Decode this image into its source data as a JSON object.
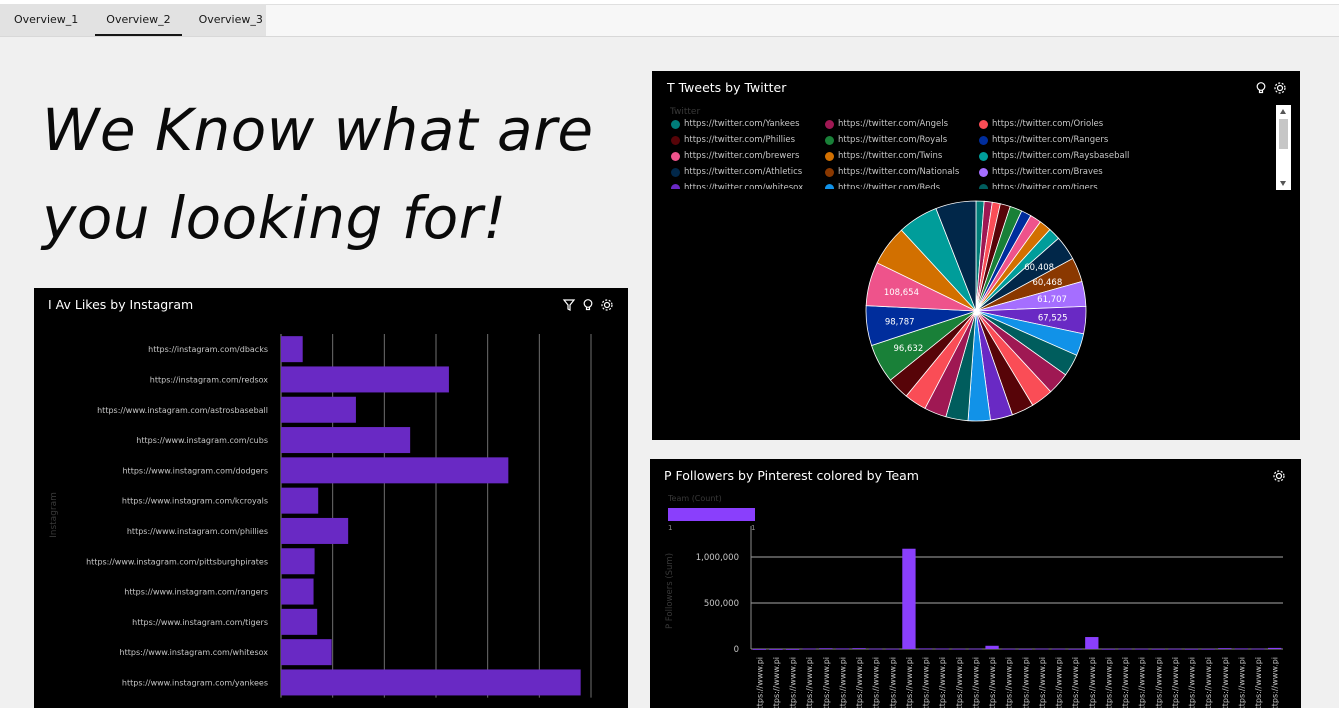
{
  "tabs": [
    {
      "label": "Overview_1"
    },
    {
      "label": "Overview_2"
    },
    {
      "label": "Overview_3"
    }
  ],
  "headline": {
    "line1": "We Know what are",
    "line2": "you looking for!"
  },
  "instagram_panel": {
    "title": "I Av Likes by Instagram",
    "ylabel": "Instagram",
    "chart_data": {
      "type": "bar",
      "orientation": "horizontal",
      "categories": [
        "https://instagram.com/dbacks",
        "https://instagram.com/redsox",
        "https://www.instagram.com/astrosbaseball",
        "https://www.instagram.com/cubs",
        "https://www.instagram.com/dodgers",
        "https://www.instagram.com/kcroyals",
        "https://www.instagram.com/phillies",
        "https://www.instagram.com/pittsburghpirates",
        "https://www.instagram.com/rangers",
        "https://www.instagram.com/tigers",
        "https://www.instagram.com/whitesox",
        "https://www.instagram.com/yankees"
      ],
      "values": [
        4.2,
        32.5,
        14.5,
        25,
        44,
        7.2,
        13,
        6.5,
        6.3,
        7,
        9.8,
        58
      ],
      "xlim": [
        0,
        60
      ],
      "grid": true,
      "color": "#6929c4"
    }
  },
  "twitter_panel": {
    "title": "T Tweets by Twitter",
    "legend_title": "Twitter",
    "legend": [
      {
        "label": "https://twitter.com/Yankees",
        "color": "#007d79"
      },
      {
        "label": "https://twitter.com/Angels",
        "color": "#9f1853"
      },
      {
        "label": "https://twitter.com/Orioles",
        "color": "#fa4d56"
      },
      {
        "label": "https://twitter.com/Phillies",
        "color": "#570408"
      },
      {
        "label": "https://twitter.com/Royals",
        "color": "#198038"
      },
      {
        "label": "https://twitter.com/Rangers",
        "color": "#002d9c"
      },
      {
        "label": "https://twitter.com/brewers",
        "color": "#ee538b"
      },
      {
        "label": "https://twitter.com/Twins",
        "color": "#d27000"
      },
      {
        "label": "https://twitter.com/Raysbaseball",
        "color": "#009d9a"
      },
      {
        "label": "https://twitter.com/Athletics",
        "color": "#012749"
      },
      {
        "label": "https://twitter.com/Nationals",
        "color": "#8a3800"
      },
      {
        "label": "https://twitter.com/Braves",
        "color": "#a56eff"
      },
      {
        "label": "https://twitter.com/whitesox",
        "color": "#6929c4"
      },
      {
        "label": "https://twitter.com/Reds",
        "color": "#1192e8"
      },
      {
        "label": "https://twitter.com/tigers",
        "color": "#005d5d"
      }
    ],
    "chart_data": {
      "type": "pie",
      "slices": [
        {
          "value": 20000,
          "color": "#007d79"
        },
        {
          "value": 20000,
          "color": "#9f1853"
        },
        {
          "value": 20000,
          "color": "#fa4d56"
        },
        {
          "value": 25000,
          "color": "#570408"
        },
        {
          "value": 30000,
          "color": "#198038"
        },
        {
          "value": 25000,
          "color": "#002d9c"
        },
        {
          "value": 28000,
          "color": "#ee538b"
        },
        {
          "value": 30000,
          "color": "#d27000"
        },
        {
          "value": 30000,
          "color": "#009d9a"
        },
        {
          "value": 60408,
          "color": "#012749",
          "label": "60,408"
        },
        {
          "value": 60468,
          "color": "#8a3800",
          "label": "60,468"
        },
        {
          "value": 61707,
          "color": "#a56eff",
          "label": "61,707"
        },
        {
          "value": 67525,
          "color": "#6929c4",
          "label": "67,525"
        },
        {
          "value": 55000,
          "color": "#1192e8"
        },
        {
          "value": 55000,
          "color": "#005d5d"
        },
        {
          "value": 55000,
          "color": "#9f1853"
        },
        {
          "value": 55000,
          "color": "#fa4d56"
        },
        {
          "value": 55000,
          "color": "#570408"
        },
        {
          "value": 55000,
          "color": "#6929c4"
        },
        {
          "value": 55000,
          "color": "#1192e8"
        },
        {
          "value": 55000,
          "color": "#005d5d"
        },
        {
          "value": 55000,
          "color": "#9f1853"
        },
        {
          "value": 55000,
          "color": "#fa4d56"
        },
        {
          "value": 55000,
          "color": "#570408"
        },
        {
          "value": 96632,
          "color": "#198038",
          "label": "96,632"
        },
        {
          "value": 98787,
          "color": "#002d9c",
          "label": "98,787"
        },
        {
          "value": 108654,
          "color": "#ee538b",
          "label": "108,654"
        },
        {
          "value": 100000,
          "color": "#d27000"
        },
        {
          "value": 100000,
          "color": "#009d9a"
        },
        {
          "value": 100000,
          "color": "#012749"
        }
      ]
    }
  },
  "pinterest_panel": {
    "title": "P Followers by Pinterest colored by Team",
    "legend_title": "Team (Count)",
    "legend_min": "1",
    "legend_max": "1",
    "ylabel": "P Followers (Sum)",
    "chart_data": {
      "type": "bar",
      "yticks": [
        "1,000,000",
        "500,000",
        "0"
      ],
      "ylim": [
        0,
        1250000
      ],
      "values": [
        0,
        0,
        0,
        5000,
        8000,
        6000,
        9000,
        4000,
        3000,
        1090000,
        6000,
        5000,
        3000,
        4000,
        35000,
        3000,
        2000,
        4000,
        3000,
        2000,
        130000,
        2000,
        4000,
        3000,
        2000,
        3000,
        2000,
        2000,
        9000,
        6000,
        4000,
        12000
      ],
      "tick_label": "https://www.pi",
      "color": "#8a3ffc"
    }
  }
}
